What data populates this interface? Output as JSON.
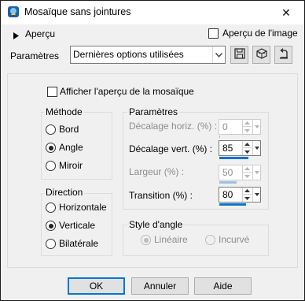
{
  "window": {
    "title": "Mosaïque sans jointures",
    "close_glyph": "✕"
  },
  "top": {
    "apercu_label": "Aperçu",
    "apercu_image_label": "Aperçu de l'image",
    "parametres_label": "Paramètres",
    "preset_value": "Dernières options utilisées",
    "icons": [
      "save-icon",
      "preset-icon",
      "reset-icon"
    ]
  },
  "afficher_label": "Afficher l'aperçu de la mosaïque",
  "methode": {
    "title": "Méthode",
    "options": [
      "Bord",
      "Angle",
      "Miroir"
    ],
    "selected": "Angle"
  },
  "direction": {
    "title": "Direction",
    "options": [
      "Horizontale",
      "Verticale",
      "Bilatérale"
    ],
    "selected": "Verticale"
  },
  "parametres": {
    "title": "Paramètres",
    "decalage_horiz": {
      "label": "Décalage horiz. (%) :",
      "value": "0",
      "enabled": false,
      "level": 0.0
    },
    "decalage_vert": {
      "label": "Décalage vert. (%) :",
      "value": "85",
      "enabled": true,
      "level": 0.85
    },
    "largeur": {
      "label": "Largeur (%) :",
      "value": "50",
      "enabled": false,
      "level": 0.5
    },
    "transition": {
      "label": "Transition (%) :",
      "value": "80",
      "enabled": true,
      "level": 0.8
    }
  },
  "style_angle": {
    "title": "Style d'angle",
    "options": [
      "Linéaire",
      "Incurvé"
    ],
    "selected": "Linéaire",
    "enabled": false
  },
  "buttons": {
    "ok": "OK",
    "annuler": "Annuler",
    "aide": "Aide"
  }
}
